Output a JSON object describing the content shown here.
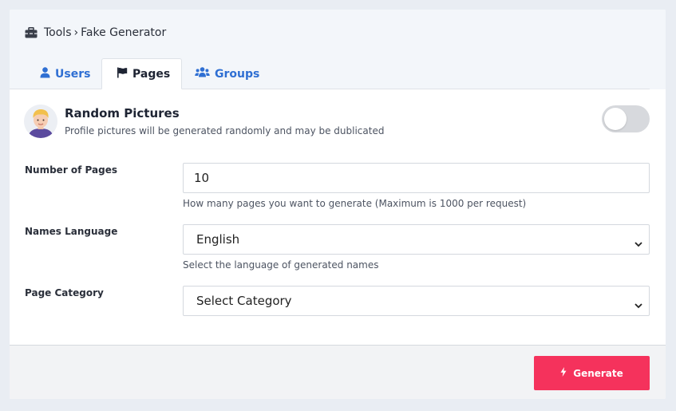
{
  "breadcrumb": {
    "icon": "toolbox-icon",
    "root": "Tools",
    "separator": "›",
    "current": "Fake Generator"
  },
  "tabs": [
    {
      "label": "Users",
      "icon": "user-icon",
      "active": false
    },
    {
      "label": "Pages",
      "icon": "flag-icon",
      "active": true
    },
    {
      "label": "Groups",
      "icon": "users-group-icon",
      "active": false
    }
  ],
  "random_pictures": {
    "title": "Random Pictures",
    "description": "Profile pictures will be generated randomly and may be dublicated",
    "enabled": false
  },
  "form": {
    "pages": {
      "label": "Number of Pages",
      "value": "10",
      "hint": "How many pages you want to generate (Maximum is 1000 per request)"
    },
    "language": {
      "label": "Names Language",
      "value": "English",
      "hint": "Select the language of generated names"
    },
    "category": {
      "label": "Page Category",
      "value": "Select Category"
    }
  },
  "footer": {
    "generate_label": "Generate",
    "icon": "bolt-icon"
  },
  "colors": {
    "accent_blue": "#2f6fd3",
    "generate_button": "#f5325c",
    "toggle_off": "#d7d9dd"
  }
}
